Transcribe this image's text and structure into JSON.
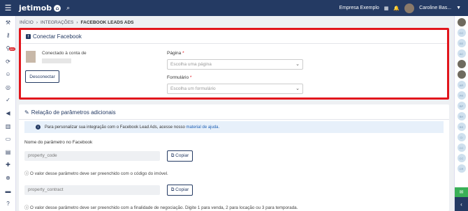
{
  "topbar": {
    "logo": "jetimob",
    "company": "Empresa Exemplo",
    "user": "Caroline Bas...",
    "icons": [
      "menu-icon",
      "home-icon",
      "search-icon",
      "grid-icon",
      "bell-icon",
      "chevron-down-icon"
    ]
  },
  "leftnav": {
    "icons": [
      "gavel-icon",
      "key-icon",
      "funnel-icon",
      "sync-icon",
      "people-icon",
      "target-icon",
      "check-icon",
      "megaphone-icon",
      "book-icon",
      "money-icon",
      "document-icon",
      "puzzle-icon",
      "globe-icon",
      "laptop-icon",
      "help-icon"
    ],
    "badge": "99+"
  },
  "breadcrumb": [
    "INÍCIO",
    "INTEGRAÇÕES",
    "FACEBOOK LEADS ADS"
  ],
  "connect": {
    "title": "Conectar Facebook",
    "connected_label": "Conectado à conta de",
    "disconnect_label": "Desconectar",
    "page_label": "Página",
    "page_placeholder": "Escolha uma página",
    "form_label": "Formulário",
    "form_placeholder": "Escolha um formulário",
    "required_mark": "*",
    "highlight_color": "#e2151c"
  },
  "params": {
    "title": "Relação de parâmetros adicionais",
    "info_text": "Para personalizar sua integração com o Facebook Lead Ads, acesse nosso",
    "info_link": "material de ajuda.",
    "column_label": "Nome do parâmetro no Facebook",
    "copy_label": "Copiar",
    "rows": [
      {
        "name": "property_code",
        "hint": "O valor desse parâmetro deve ser preenchido com o código do imóvel."
      },
      {
        "name": "property_contract",
        "hint": "O valor desse parâmetro deve ser preenchido com a finalidade de negociação. Digite 1 para venda, 2 para locação ou 3 para temporada."
      }
    ]
  },
  "rightbar": {
    "avatars": [
      "CC",
      "",
      "EE",
      "AC",
      "",
      "",
      "AR",
      "PR",
      "",
      "BP",
      "BH",
      "BS",
      "CI",
      "CC",
      "CC",
      "CR",
      "CC"
    ]
  },
  "colors": {
    "brand": "#243a63",
    "accent": "#1e5fb3"
  }
}
